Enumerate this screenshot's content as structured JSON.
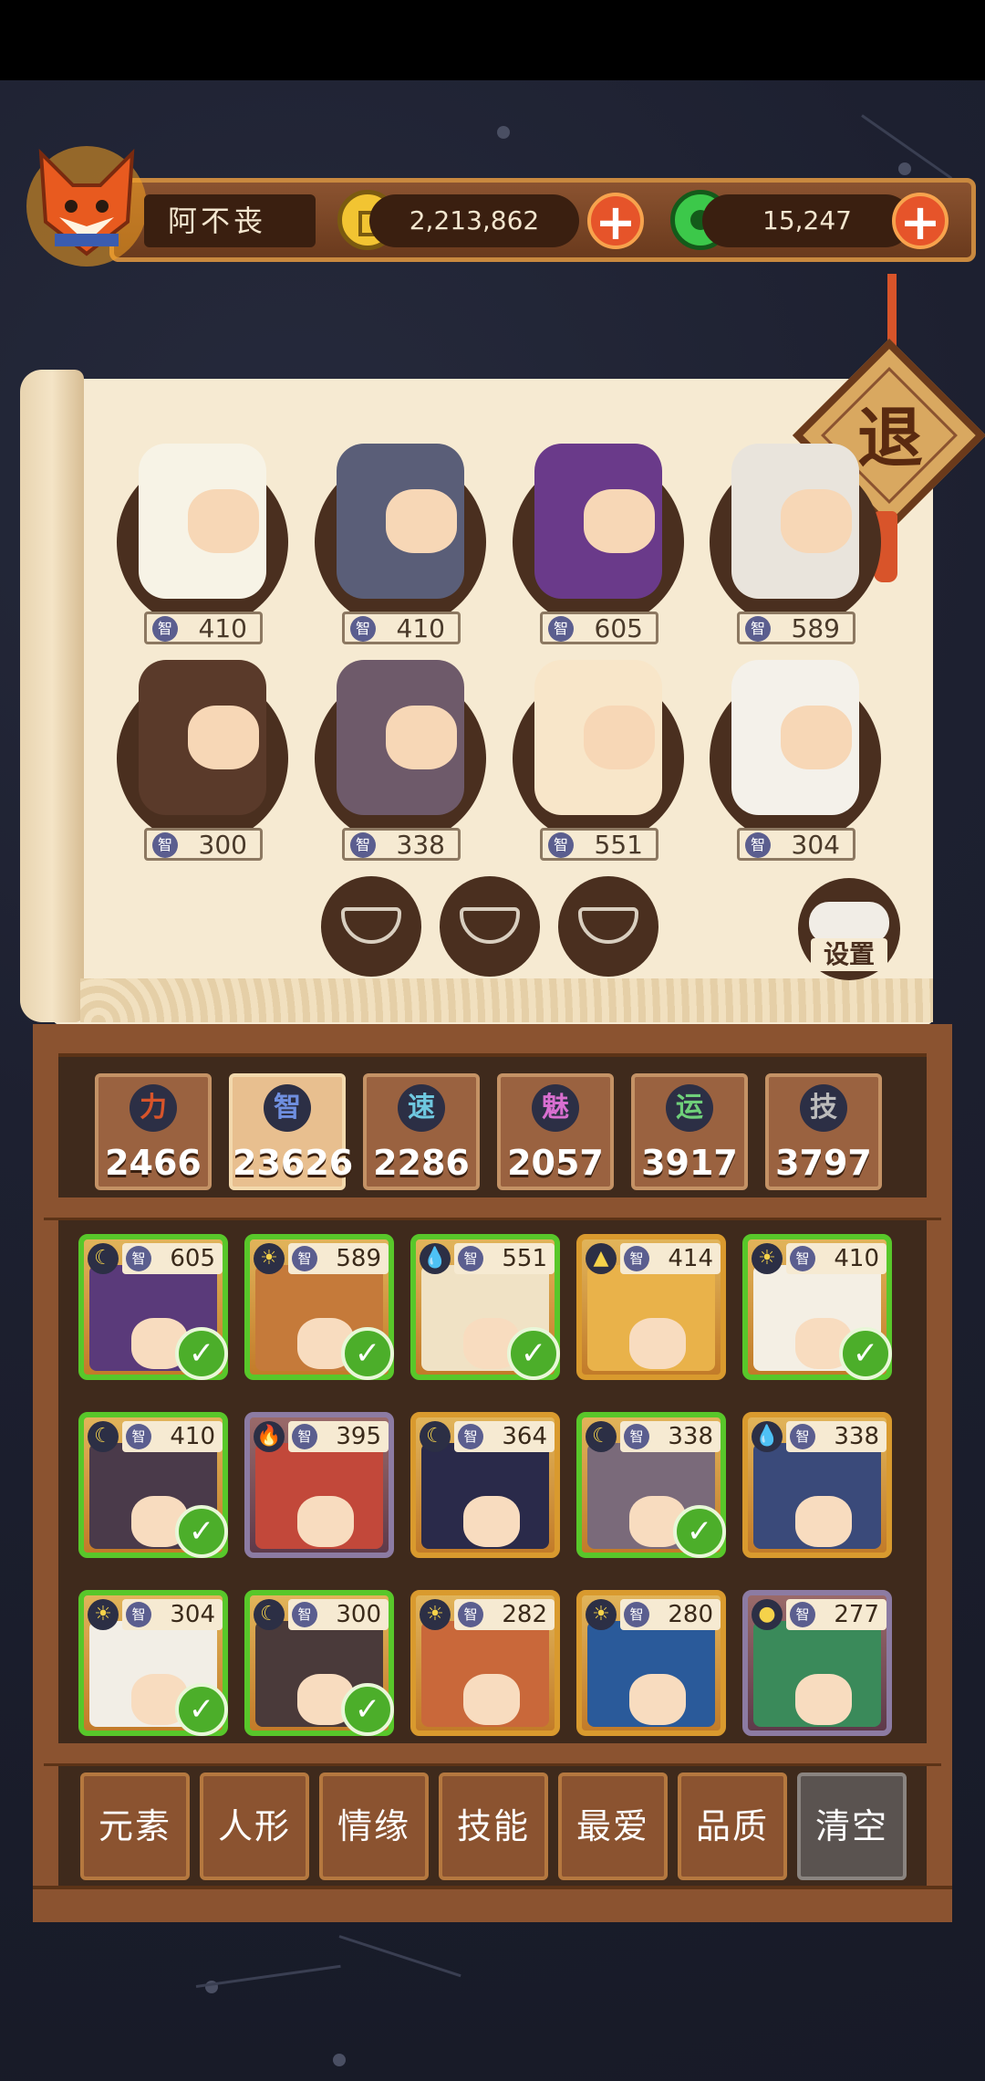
{
  "player": {
    "name": "阿不丧"
  },
  "currency": {
    "coins": "2,213,862",
    "jade": "15,247"
  },
  "exit_label": "退",
  "settings_label": "设置",
  "stat_icon_label": "智",
  "team": [
    {
      "value": "410"
    },
    {
      "value": "410"
    },
    {
      "value": "605"
    },
    {
      "value": "589"
    },
    {
      "value": "300"
    },
    {
      "value": "338"
    },
    {
      "value": "551"
    },
    {
      "value": "304"
    }
  ],
  "stats": [
    {
      "icon": "力",
      "value": "2466",
      "color": "#d8542a"
    },
    {
      "icon": "智",
      "value": "23626",
      "color": "#6f8fe0",
      "active": true
    },
    {
      "icon": "速",
      "value": "2286",
      "color": "#6fc8e0"
    },
    {
      "icon": "魅",
      "value": "2057",
      "color": "#d86fd0"
    },
    {
      "icon": "运",
      "value": "3917",
      "color": "#6fd07a"
    },
    {
      "icon": "技",
      "value": "3797",
      "color": "#bbbbbb"
    }
  ],
  "heroes": [
    {
      "value": "605",
      "element": "moon",
      "selected": true
    },
    {
      "value": "589",
      "element": "sun",
      "selected": true
    },
    {
      "value": "551",
      "element": "water",
      "selected": true
    },
    {
      "value": "414",
      "element": "earth",
      "selected": false
    },
    {
      "value": "410",
      "element": "sun",
      "selected": true
    },
    {
      "value": "410",
      "element": "moon",
      "selected": true
    },
    {
      "value": "395",
      "element": "fire",
      "selected": false,
      "rarity": "purple"
    },
    {
      "value": "364",
      "element": "moon",
      "selected": false
    },
    {
      "value": "338",
      "element": "moon",
      "selected": true
    },
    {
      "value": "338",
      "element": "water",
      "selected": false
    },
    {
      "value": "304",
      "element": "sun",
      "selected": true
    },
    {
      "value": "300",
      "element": "moon",
      "selected": true
    },
    {
      "value": "282",
      "element": "sun",
      "selected": false
    },
    {
      "value": "280",
      "element": "sun",
      "selected": false
    },
    {
      "value": "277",
      "element": "wood",
      "selected": false,
      "rarity": "purple"
    }
  ],
  "filters": [
    "元素",
    "人形",
    "情缘",
    "技能",
    "最爱",
    "品质",
    "清空"
  ],
  "colors": {
    "accent_orange": "#e6542a",
    "selected_green": "#58c72a",
    "wood": "#8b5330"
  }
}
